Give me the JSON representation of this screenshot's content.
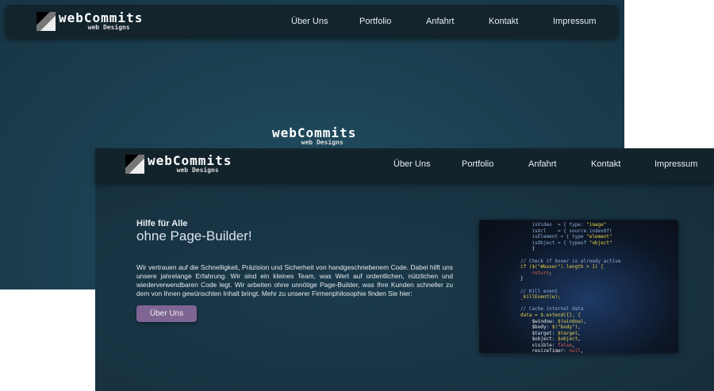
{
  "brand": {
    "name": "webCommits",
    "tagline": "web Designs"
  },
  "nav": {
    "items": [
      "Über Uns",
      "Portfolio",
      "Anfahrt",
      "Kontakt",
      "Impressum"
    ]
  },
  "hero": {
    "kicker": "Hilfe für Alle",
    "title": "ohne Page-Builder!",
    "text": "Wir vertrauen auf die Schnelligkeit, Präzision und Sicherheit von handgeschriebenem Code. Dabei hilft uns unsere jahrelange Erfahrung. Wir sind ein kleines Team, was Wert auf ordentlichen, nützlichen und wiederverwendbaren Code legt. Wir arbeiten ohne unnötige Page-Builder, was Ihre Kunden schneller zu dem von Ihnen gewünschten Inhalt bringt. Mehr zu unserer Firmenphilosophie finden Sie hier:",
    "button": "Über Uns"
  }
}
